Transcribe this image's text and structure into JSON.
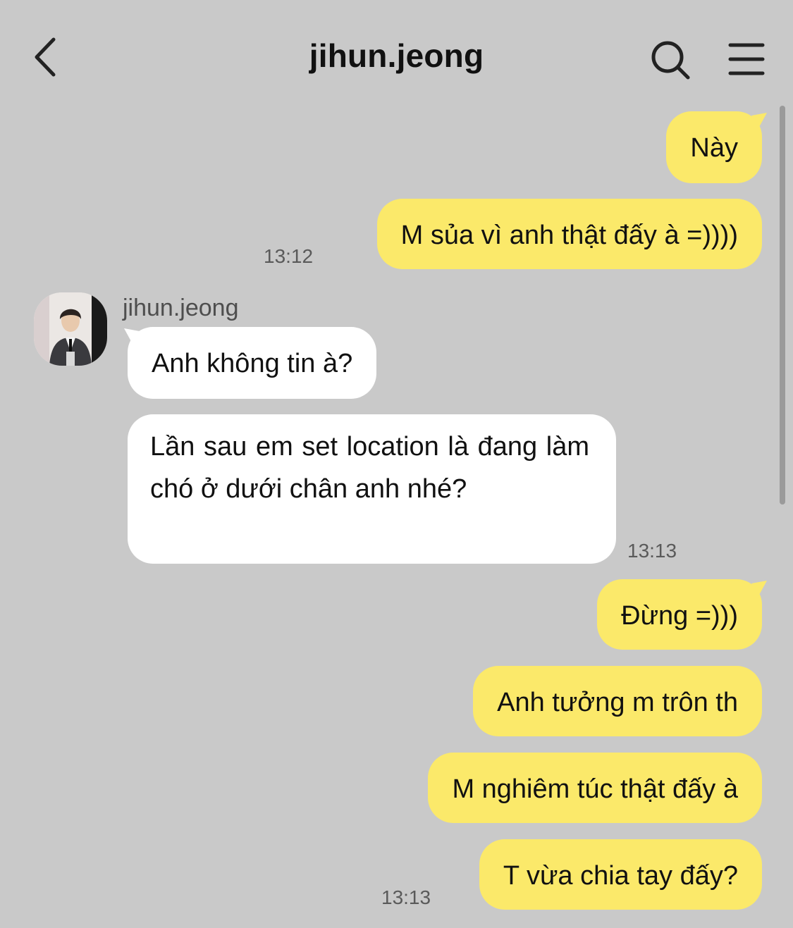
{
  "header": {
    "title": "jihun.jeong",
    "back_icon": "chevron-left-icon",
    "search_icon": "search-icon",
    "menu_icon": "hamburger-menu-icon"
  },
  "colors": {
    "background": "#c9c9c9",
    "my_bubble": "#fbe96a",
    "their_bubble": "#ffffff",
    "timestamp": "#5a5a5a"
  },
  "contact": {
    "name": "jihun.jeong"
  },
  "messages": [
    {
      "sender": "me",
      "text": "Này"
    },
    {
      "sender": "me",
      "text": "M sủa vì anh thật đấy à =))))",
      "time": "13:12"
    },
    {
      "sender": "jihun.jeong",
      "text": "Anh không tin à?"
    },
    {
      "sender": "jihun.jeong",
      "text": "Lần sau em set location là đang làm chó ở dưới chân anh nhé?",
      "time": "13:13"
    },
    {
      "sender": "me",
      "text": "Đừng =)))"
    },
    {
      "sender": "me",
      "text": "Anh tưởng m trôn th"
    },
    {
      "sender": "me",
      "text": "M nghiêm túc thật đấy à"
    },
    {
      "sender": "me",
      "text": "T vừa chia tay đấy?",
      "time": "13:13"
    }
  ]
}
